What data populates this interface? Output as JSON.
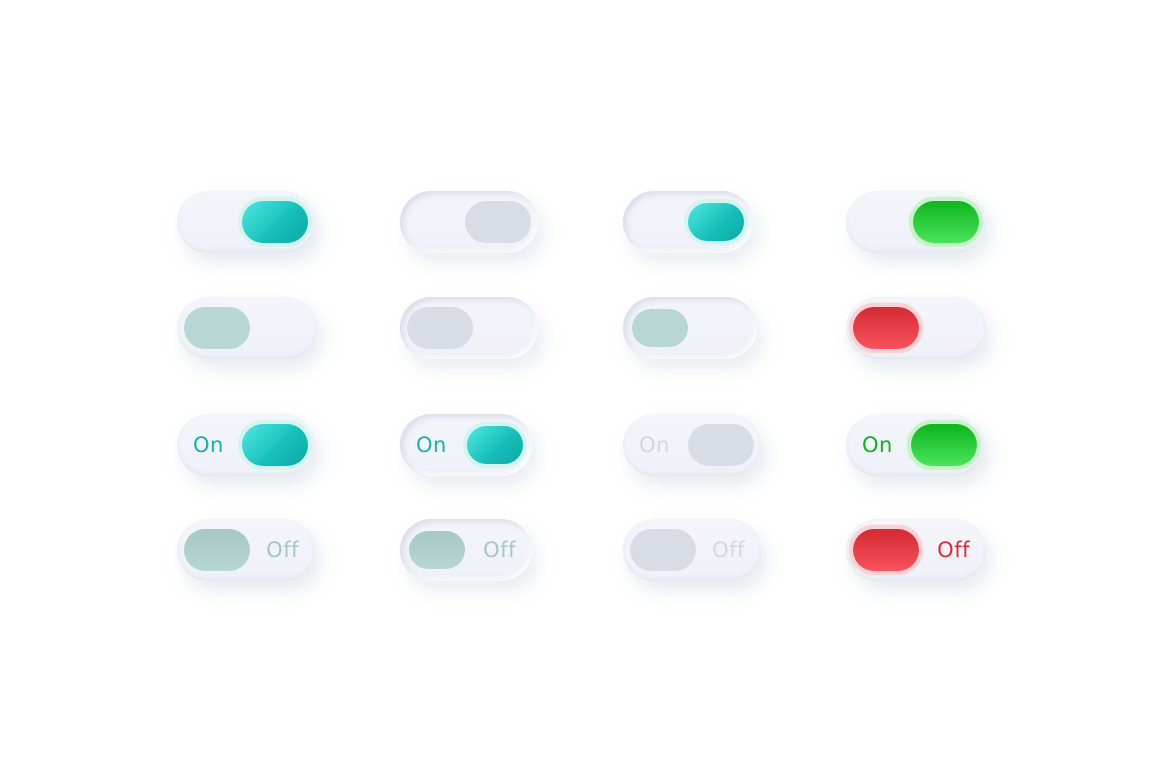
{
  "colors": {
    "teal": "#14bdb8",
    "green": "#1ec730",
    "red": "#e63a44",
    "sage": "#b8d6d3",
    "disabled": "#d8dde5",
    "track": "#f1f3f9"
  },
  "rows": [
    [
      {
        "state": "on",
        "variant": "teal",
        "size": "large",
        "style": "raised",
        "label": ""
      },
      {
        "state": "on",
        "variant": "disabled",
        "size": "large",
        "style": "inset",
        "label": ""
      },
      {
        "state": "on",
        "variant": "teal",
        "size": "small",
        "style": "inset",
        "label": ""
      },
      {
        "state": "on",
        "variant": "green",
        "size": "large",
        "style": "raised",
        "label": ""
      }
    ],
    [
      {
        "state": "off",
        "variant": "sage",
        "size": "large",
        "style": "raised",
        "label": ""
      },
      {
        "state": "off",
        "variant": "disabled",
        "size": "large",
        "style": "inset",
        "label": ""
      },
      {
        "state": "off",
        "variant": "sage",
        "size": "small",
        "style": "inset",
        "label": ""
      },
      {
        "state": "off",
        "variant": "red",
        "size": "large",
        "style": "raised",
        "label": ""
      }
    ],
    [
      {
        "state": "on",
        "variant": "teal",
        "size": "large",
        "style": "raised",
        "label": "On"
      },
      {
        "state": "on",
        "variant": "teal",
        "size": "small",
        "style": "inset",
        "label": "On"
      },
      {
        "state": "on",
        "variant": "disabled",
        "size": "large",
        "style": "raised",
        "label": "On"
      },
      {
        "state": "on",
        "variant": "green",
        "size": "large",
        "style": "raised",
        "label": "On"
      }
    ],
    [
      {
        "state": "off",
        "variant": "sage",
        "size": "large",
        "style": "raised",
        "label": "Off"
      },
      {
        "state": "off",
        "variant": "sage",
        "size": "small",
        "style": "inset",
        "label": "Off"
      },
      {
        "state": "off",
        "variant": "disabled",
        "size": "large",
        "style": "raised",
        "label": "Off"
      },
      {
        "state": "off",
        "variant": "red",
        "size": "large",
        "style": "raised",
        "label": "Off"
      }
    ]
  ]
}
